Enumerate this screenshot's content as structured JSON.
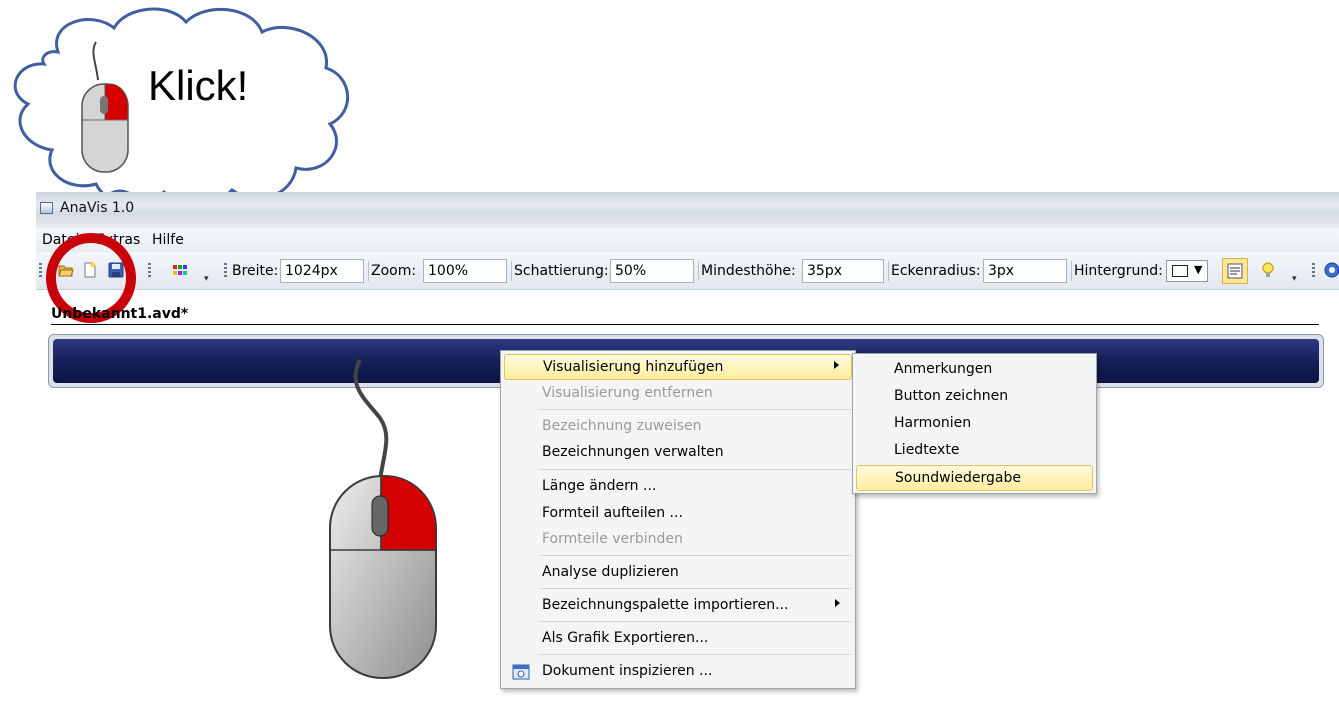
{
  "callout": {
    "text": "Klick!"
  },
  "window": {
    "title": "AnaVis 1.0"
  },
  "menubar": {
    "items": [
      "Datei",
      "Extras",
      "Hilfe"
    ]
  },
  "toolbar": {
    "breite_label": "Breite:",
    "breite_value": "1024px",
    "zoom_label": "Zoom:",
    "zoom_value": "100%",
    "schattierung_label": "Schattierung:",
    "schattierung_value": "50%",
    "mindesthoehe_label": "Mindesthöhe:",
    "mindesthoehe_value": "35px",
    "eckenradius_label": "Eckenradius:",
    "eckenradius_value": "3px",
    "hintergrund_label": "Hintergrund:"
  },
  "document": {
    "tab_title": "Unbekannt1.avd*"
  },
  "context_menu": {
    "items": [
      {
        "label": "Visualisierung hinzufügen",
        "disabled": false,
        "submenu": true,
        "highlighted": true
      },
      {
        "label": "Visualisierung entfernen",
        "disabled": true
      },
      {
        "label": "Bezeichnung zuweisen",
        "disabled": true
      },
      {
        "label": "Bezeichnungen verwalten",
        "disabled": false
      },
      {
        "label": "Länge ändern ...",
        "disabled": false
      },
      {
        "label": "Formteil aufteilen ...",
        "disabled": false
      },
      {
        "label": "Formteile verbinden",
        "disabled": true
      },
      {
        "label": "Analyse duplizieren",
        "disabled": false
      },
      {
        "label": "Bezeichnungspalette importieren...",
        "disabled": false,
        "submenu": true
      },
      {
        "label": "Als Grafik Exportieren...",
        "disabled": false
      },
      {
        "label": "Dokument inspizieren ...",
        "disabled": false,
        "icon": "inspect-document-icon"
      }
    ]
  },
  "submenu": {
    "items": [
      {
        "label": "Anmerkungen"
      },
      {
        "label": "Button zeichnen"
      },
      {
        "label": "Harmonien"
      },
      {
        "label": "Liedtexte"
      },
      {
        "label": "Soundwiedergabe",
        "highlighted": true
      }
    ]
  },
  "colors": {
    "highlight_fill": "#ffee9e",
    "highlight_border": "#e5c35b",
    "bar_blue": "#17215a",
    "mouse_button_red": "#d40000",
    "callout_ring_red": "#c8000a",
    "cloud_outline": "#3f5fa0"
  }
}
